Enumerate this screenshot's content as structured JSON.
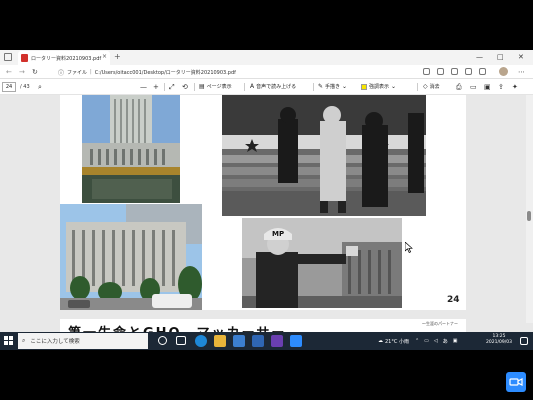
{
  "browser": {
    "tab_title": "ロータリー資料20210903.pdf",
    "tab_close": "×",
    "new_tab": "+",
    "window_minimize": "—",
    "window_maximize": "□",
    "window_close": "✕",
    "address_scheme": "ファイル",
    "address_path": "C:/Users/oitacc001/Desktop/ロータリー資料20210903.pdf"
  },
  "pdf_toolbar": {
    "page_current": "24",
    "page_total": "/ 43",
    "zoom_out": "—",
    "zoom_in": "+",
    "page_view": "ページ表示",
    "read_aloud": "音声で読み上げる",
    "draw": "手描き",
    "highlight": "強調表示",
    "erase": "消去"
  },
  "page": {
    "page_number": "24",
    "next_heading": "第一生命とGHQ　マッカーサー",
    "next_subnote": "〜生涯のパートナー"
  },
  "taskbar": {
    "search_placeholder": "ここに入力して検索",
    "weather": "21°C 小雨",
    "ime": "あ",
    "time": "13:25",
    "date": "2021/09/03"
  },
  "colors": {
    "taskbar": "#1c2836",
    "pdf_badge": "#d2312c",
    "highlight": "#f5e400",
    "zoom_button": "#2d8cff"
  }
}
